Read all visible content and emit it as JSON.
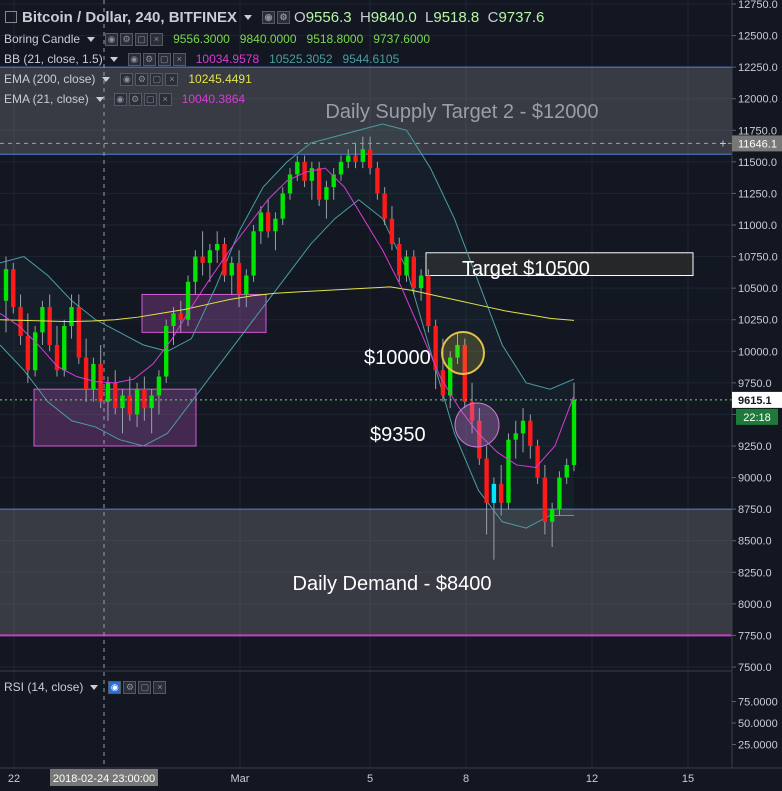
{
  "header": {
    "symbol_title": "Bitcoin / Dollar, 240, BITFINEX",
    "ohlc": {
      "o_label": "O",
      "o": "9556.3",
      "h_label": "H",
      "h": "9840.0",
      "l_label": "L",
      "l": "9518.8",
      "c_label": "C",
      "c": "9737.6"
    }
  },
  "legends": {
    "candle": {
      "name": "Boring Candle",
      "values": [
        "9556.3000",
        "9840.0000",
        "9518.8000",
        "9737.6000"
      ]
    },
    "bb": {
      "name": "BB (21, close, 1.5)",
      "values": [
        "10034.9578",
        "10525.3052",
        "9544.6105"
      ]
    },
    "ema200": {
      "name": "EMA (200, close)",
      "value": "10245.4491"
    },
    "ema21": {
      "name": "EMA (21, close)",
      "value": "10040.3864"
    },
    "rsi": {
      "name": "RSI (14, close)"
    }
  },
  "colors": {
    "bg": "#131722",
    "up": "#00e600",
    "down": "#ff1a1a",
    "up_alt": "#00e5ff",
    "bb": "#4a9ea0",
    "ema200": "#e3e34a",
    "ema21": "#d63cd6",
    "zone": "#9a9a9a",
    "box": "#d65ad6",
    "cursor_bg": "#787878",
    "last_bg": "#ffffff"
  },
  "annotations": {
    "supply": "Daily Supply Target 2 - $12000",
    "target": "Target $10500",
    "p10000": "$10000",
    "p9350": "$9350",
    "demand": "Daily Demand - $8400"
  },
  "price_scale": {
    "ticks": [
      "12750.0",
      "12500.0",
      "12250.0",
      "12000.0",
      "11750.0",
      "11500.0",
      "11250.0",
      "11000.0",
      "10750.0",
      "10500.0",
      "10250.0",
      "10000.0",
      "9750.0",
      "9500.0",
      "9250.0",
      "9000.0",
      "8750.0",
      "8500.0",
      "8250.0",
      "8000.0",
      "7750.0",
      "7500.0"
    ],
    "cursor_label": "11646.1",
    "last_label": "9615.1",
    "countdown": "22:18"
  },
  "rsi_scale": {
    "ticks": [
      "75.0000",
      "50.0000",
      "25.0000"
    ]
  },
  "time_axis": {
    "ticks": [
      "22",
      "Mar",
      "5",
      "8",
      "12",
      "15"
    ],
    "cursor_label": "2018-02-24 23:00:00"
  },
  "chart_data": {
    "type": "candlestick",
    "title": "Bitcoin / Dollar, 240, BITFINEX",
    "ylim": [
      7500,
      12800
    ],
    "x_ticks": [
      "22",
      "Mar",
      "5",
      "8",
      "12",
      "15"
    ],
    "ohlc_series": [
      [
        10400,
        10750,
        10150,
        10650
      ],
      [
        10650,
        10700,
        10300,
        10350
      ],
      [
        10350,
        10450,
        10050,
        10120
      ],
      [
        10120,
        10300,
        9750,
        9850
      ],
      [
        9850,
        10200,
        9800,
        10150
      ],
      [
        10150,
        10400,
        10050,
        10350
      ],
      [
        10350,
        10450,
        10000,
        10050
      ],
      [
        10050,
        10200,
        9800,
        9850
      ],
      [
        9850,
        10250,
        9800,
        10200
      ],
      [
        10200,
        10450,
        10100,
        10350
      ],
      [
        10350,
        10450,
        9900,
        9950
      ],
      [
        9950,
        10100,
        9600,
        9700
      ],
      [
        9700,
        9950,
        9600,
        9900
      ],
      [
        9900,
        10050,
        9550,
        9600
      ],
      [
        9600,
        9800,
        9450,
        9750
      ],
      [
        9750,
        9850,
        9500,
        9550
      ],
      [
        9550,
        9700,
        9350,
        9650
      ],
      [
        9650,
        9800,
        9450,
        9500
      ],
      [
        9500,
        9750,
        9400,
        9700
      ],
      [
        9700,
        9800,
        9450,
        9550
      ],
      [
        9550,
        9700,
        9350,
        9650
      ],
      [
        9650,
        9850,
        9500,
        9800
      ],
      [
        9800,
        10250,
        9750,
        10200
      ],
      [
        10200,
        10350,
        10050,
        10300
      ],
      [
        10300,
        10400,
        10150,
        10250
      ],
      [
        10250,
        10600,
        10200,
        10550
      ],
      [
        10550,
        10800,
        10450,
        10750
      ],
      [
        10750,
        10950,
        10600,
        10700
      ],
      [
        10700,
        10850,
        10550,
        10800
      ],
      [
        10800,
        10950,
        10700,
        10850
      ],
      [
        10850,
        10900,
        10550,
        10600
      ],
      [
        10600,
        10750,
        10450,
        10700
      ],
      [
        10700,
        10800,
        10350,
        10450
      ],
      [
        10450,
        10650,
        10350,
        10600
      ],
      [
        10600,
        11000,
        10550,
        10950
      ],
      [
        10950,
        11150,
        10850,
        11100
      ],
      [
        11100,
        11200,
        10900,
        10950
      ],
      [
        10950,
        11100,
        10800,
        11050
      ],
      [
        11050,
        11300,
        11000,
        11250
      ],
      [
        11250,
        11450,
        11200,
        11400
      ],
      [
        11400,
        11550,
        11350,
        11500
      ],
      [
        11500,
        11550,
        11300,
        11350
      ],
      [
        11350,
        11500,
        11200,
        11450
      ],
      [
        11450,
        11500,
        11150,
        11200
      ],
      [
        11200,
        11350,
        11050,
        11300
      ],
      [
        11300,
        11450,
        11200,
        11400
      ],
      [
        11400,
        11550,
        11350,
        11500
      ],
      [
        11500,
        11600,
        11450,
        11550
      ],
      [
        11550,
        11650,
        11450,
        11500
      ],
      [
        11500,
        11700,
        11450,
        11600
      ],
      [
        11600,
        11700,
        11400,
        11450
      ],
      [
        11450,
        11500,
        11200,
        11250
      ],
      [
        11250,
        11300,
        11000,
        11050
      ],
      [
        11050,
        11150,
        10800,
        10850
      ],
      [
        10850,
        10900,
        10550,
        10600
      ],
      [
        10600,
        10800,
        10550,
        10750
      ],
      [
        10750,
        10800,
        10450,
        10500
      ],
      [
        10500,
        10650,
        10400,
        10600
      ],
      [
        10600,
        10650,
        10150,
        10200
      ],
      [
        10200,
        10250,
        9700,
        9850
      ],
      [
        9850,
        10100,
        9600,
        9650
      ],
      [
        9650,
        10000,
        9550,
        9950
      ],
      [
        9950,
        10150,
        9900,
        10050
      ],
      [
        10050,
        10100,
        9550,
        9600
      ],
      [
        9600,
        9750,
        9350,
        9450
      ],
      [
        9450,
        9550,
        9100,
        9150
      ],
      [
        9150,
        9250,
        8550,
        8800
      ],
      [
        8800,
        9000,
        8350,
        8950
      ],
      [
        8950,
        9100,
        8700,
        8800
      ],
      [
        8800,
        9350,
        8750,
        9300
      ],
      [
        9300,
        9450,
        9150,
        9350
      ],
      [
        9350,
        9550,
        9200,
        9450
      ],
      [
        9450,
        9500,
        9150,
        9250
      ],
      [
        9250,
        9300,
        8950,
        9000
      ],
      [
        9000,
        9100,
        8550,
        8650
      ],
      [
        8650,
        8800,
        8450,
        8750
      ],
      [
        8750,
        9050,
        8700,
        9000
      ],
      [
        9000,
        9150,
        8950,
        9100
      ],
      [
        9100,
        9750,
        9050,
        9615
      ]
    ],
    "ema200": [
      10250,
      10245,
      10240,
      10235,
      10240,
      10250,
      10270,
      10300,
      10330,
      10370,
      10410,
      10440,
      10460,
      10470,
      10480,
      10490,
      10500,
      10510,
      10480,
      10440,
      10400,
      10360,
      10320,
      10290,
      10260,
      10245
    ],
    "ema21": [
      10300,
      10200,
      10050,
      9880,
      9800,
      9760,
      9750,
      9780,
      9900,
      10100,
      10350,
      10580,
      10800,
      11000,
      11200,
      11350,
      11420,
      11450,
      11300,
      11050,
      10800,
      10500,
      10150,
      9800,
      9550,
      9350,
      9200,
      9100,
      9080,
      9250,
      9650
    ],
    "bb_upper": [
      10700,
      10750,
      10600,
      10400,
      10250,
      10150,
      10050,
      10000,
      10100,
      10500,
      10950,
      11300,
      11500,
      11650,
      11700,
      11750,
      11800,
      11750,
      11450,
      11050,
      10550,
      10050,
      9750,
      9700,
      9780
    ],
    "bb_lower": [
      10050,
      9850,
      9600,
      9450,
      9400,
      9300,
      9250,
      9350,
      9600,
      9850,
      10100,
      10350,
      10600,
      10850,
      11050,
      11200,
      11050,
      10650,
      10000,
      9350,
      8900,
      8650,
      8600,
      8700,
      8700
    ],
    "zones": [
      {
        "label": "Daily Supply Target 2 - $12000",
        "from": 11560,
        "to": 12250
      },
      {
        "label": "Daily Demand - $8400",
        "from": 7750,
        "to": 8750
      }
    ],
    "boxes": [
      {
        "from": 10150,
        "to": 10450
      },
      {
        "from": 9250,
        "to": 9700
      },
      {
        "from": 10600,
        "to": 10780,
        "label": "Target $10500"
      }
    ],
    "circles": [
      {
        "label": "$10000",
        "value": 9980
      },
      {
        "label": "$9350",
        "value": 9350
      }
    ],
    "last_price": 9615.1,
    "rsi_ticks": [
      75,
      50,
      25
    ]
  }
}
